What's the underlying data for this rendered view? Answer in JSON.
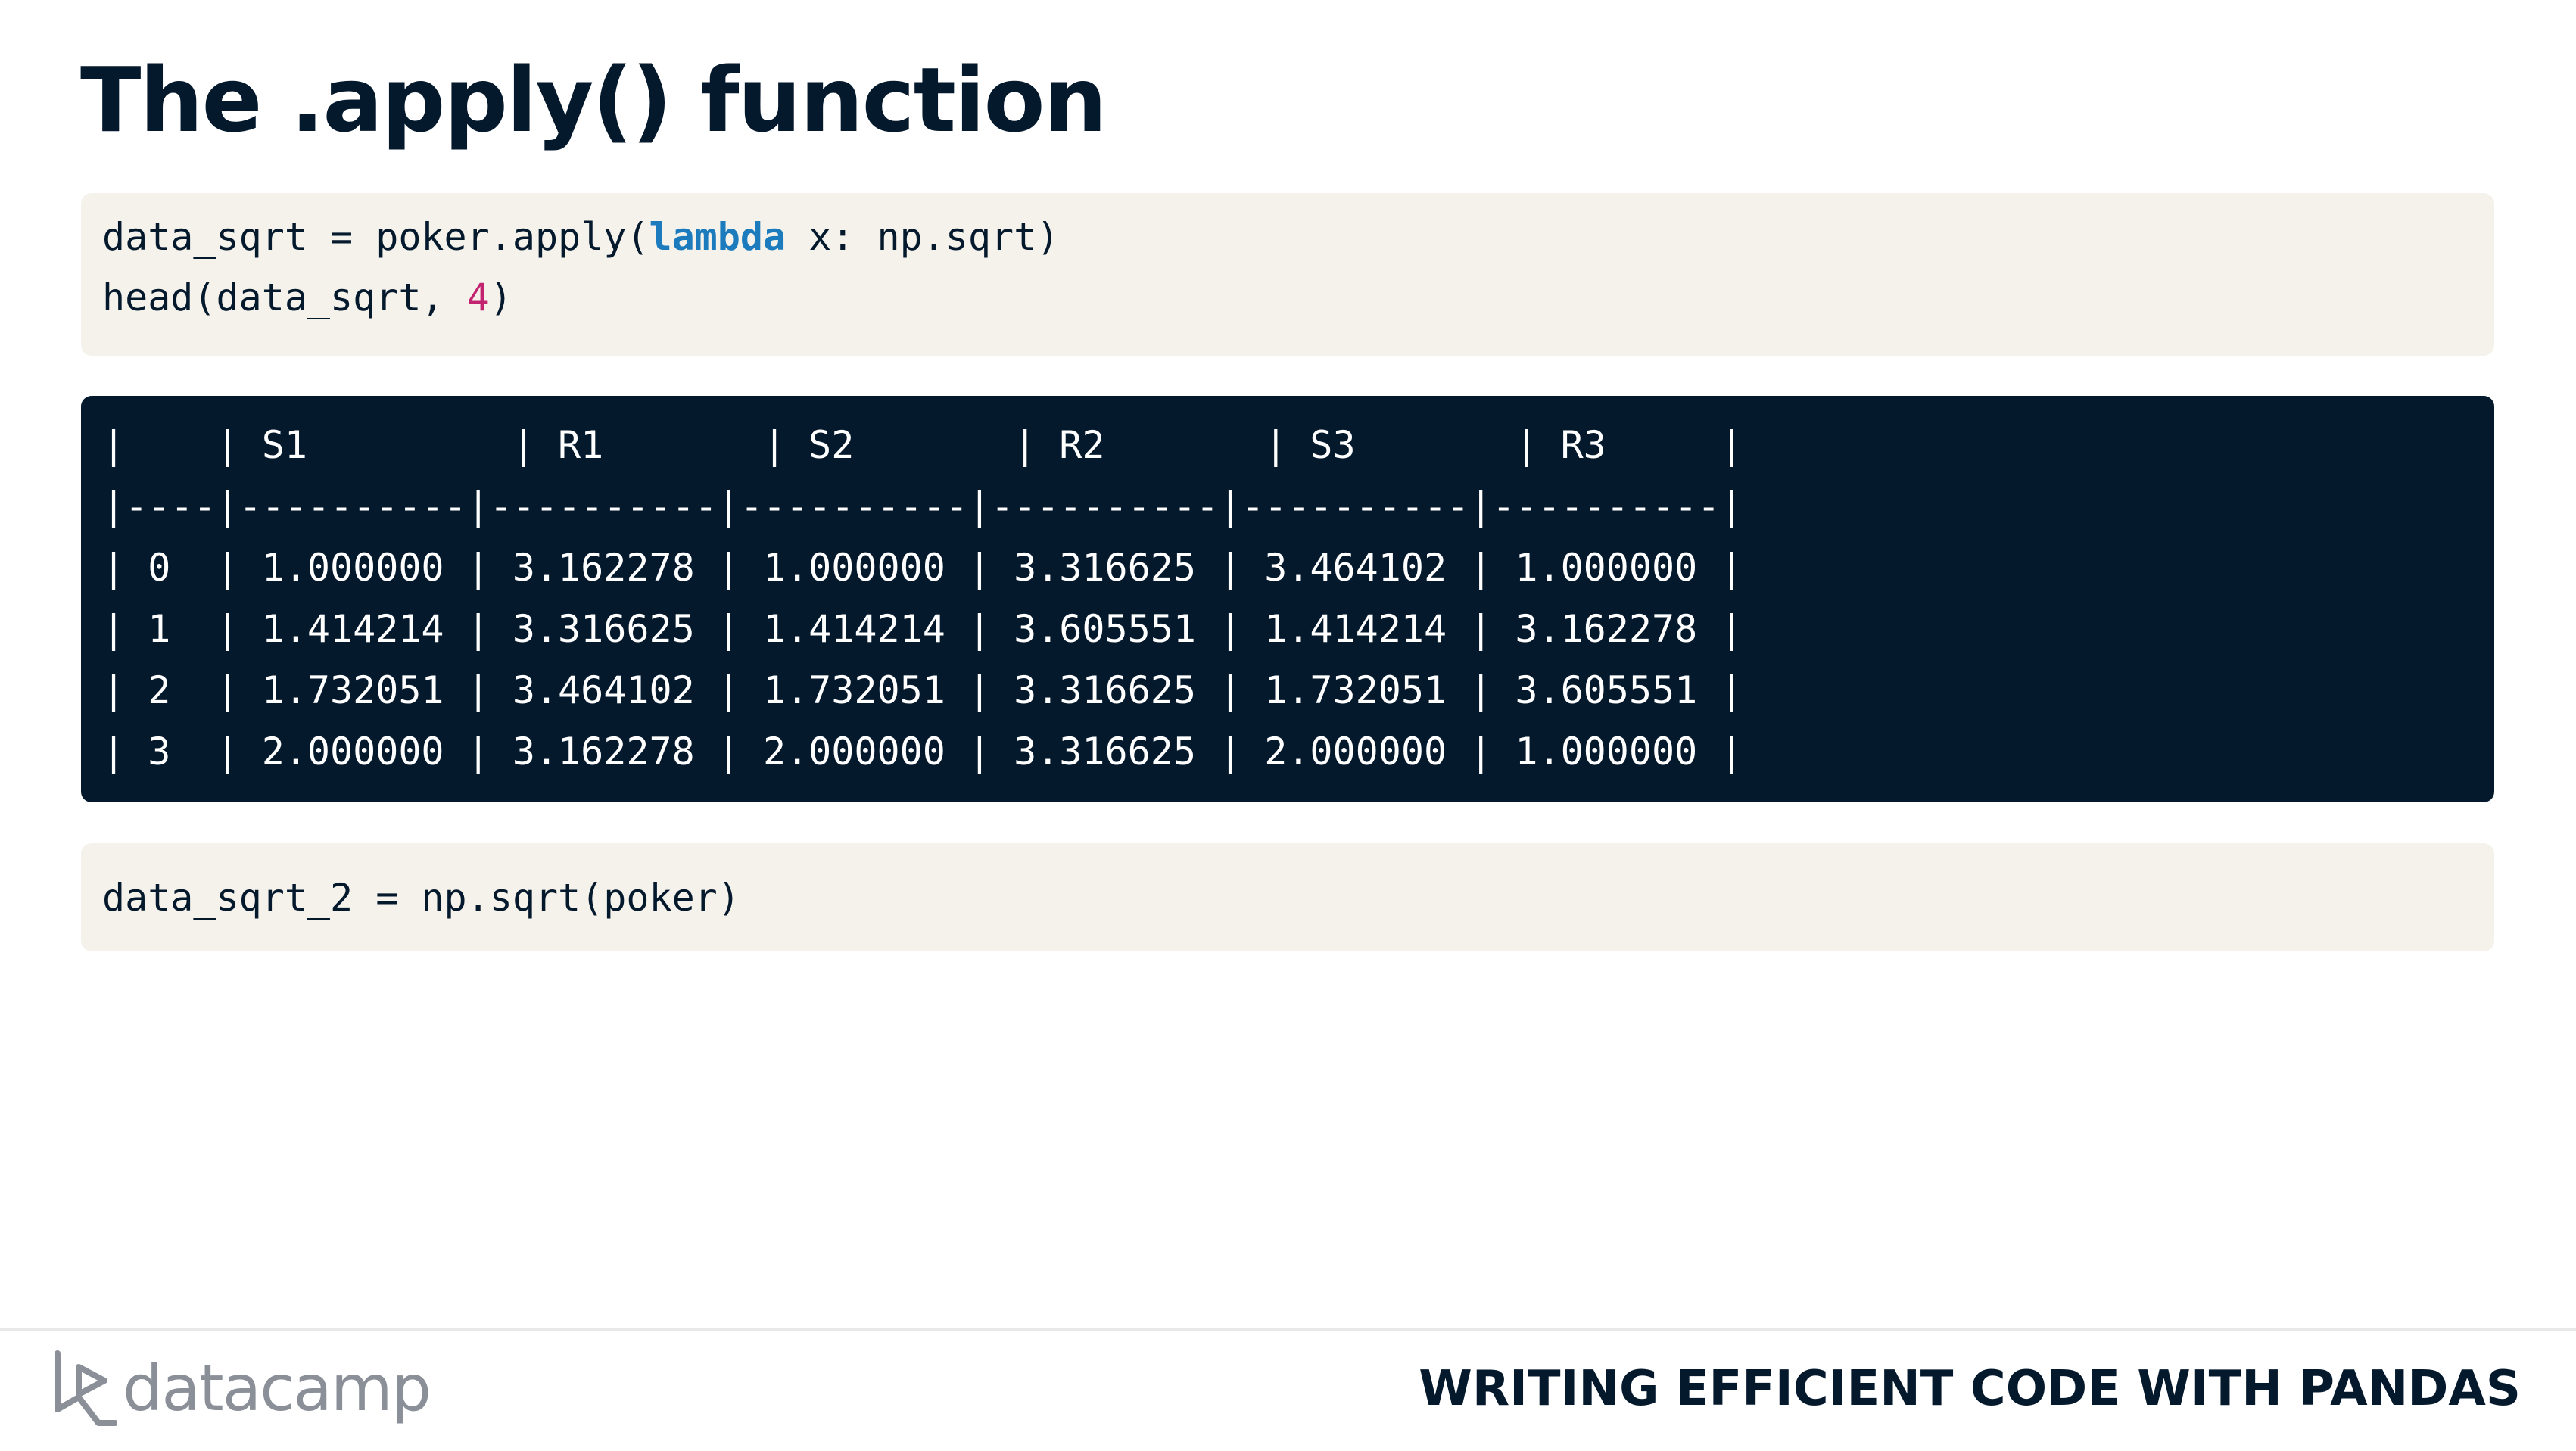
{
  "slide": {
    "title": "The .apply() function"
  },
  "code_block_1": {
    "line1": {
      "prefix": "data_sqrt = poker.apply(",
      "keyword": "lambda",
      "suffix": " x: np.sqrt)"
    },
    "line2": {
      "prefix": "head(data_sqrt, ",
      "number": "4",
      "suffix": ")"
    }
  },
  "output_block": {
    "lines": [
      "|    | S1         | R1       | S2       | R2       | S3       | R3     |",
      "|----|----------|----------|----------|----------|----------|----------|",
      "| 0  | 1.000000 | 3.162278 | 1.000000 | 3.316625 | 3.464102 | 1.000000 |",
      "| 1  | 1.414214 | 3.316625 | 1.414214 | 3.605551 | 1.414214 | 3.162278 |",
      "| 2  | 1.732051 | 3.464102 | 1.732051 | 3.316625 | 1.732051 | 3.605551 |",
      "| 3  | 2.000000 | 3.162278 | 2.000000 | 3.316625 | 2.000000 | 1.000000 |"
    ]
  },
  "code_block_2": {
    "line1": "data_sqrt_2 = np.sqrt(poker)"
  },
  "footer": {
    "logo_text": "datacamp",
    "course_title": "WRITING EFFICIENT CODE WITH PANDAS"
  },
  "colors": {
    "title": "#05192d",
    "code_background": "#f5f2ec",
    "output_background": "#05192d",
    "keyword": "#1b7bbd",
    "number": "#c3246f",
    "logo": "#8a8f98"
  },
  "icons": {
    "logo_mark": "datacamp-logo-icon"
  }
}
